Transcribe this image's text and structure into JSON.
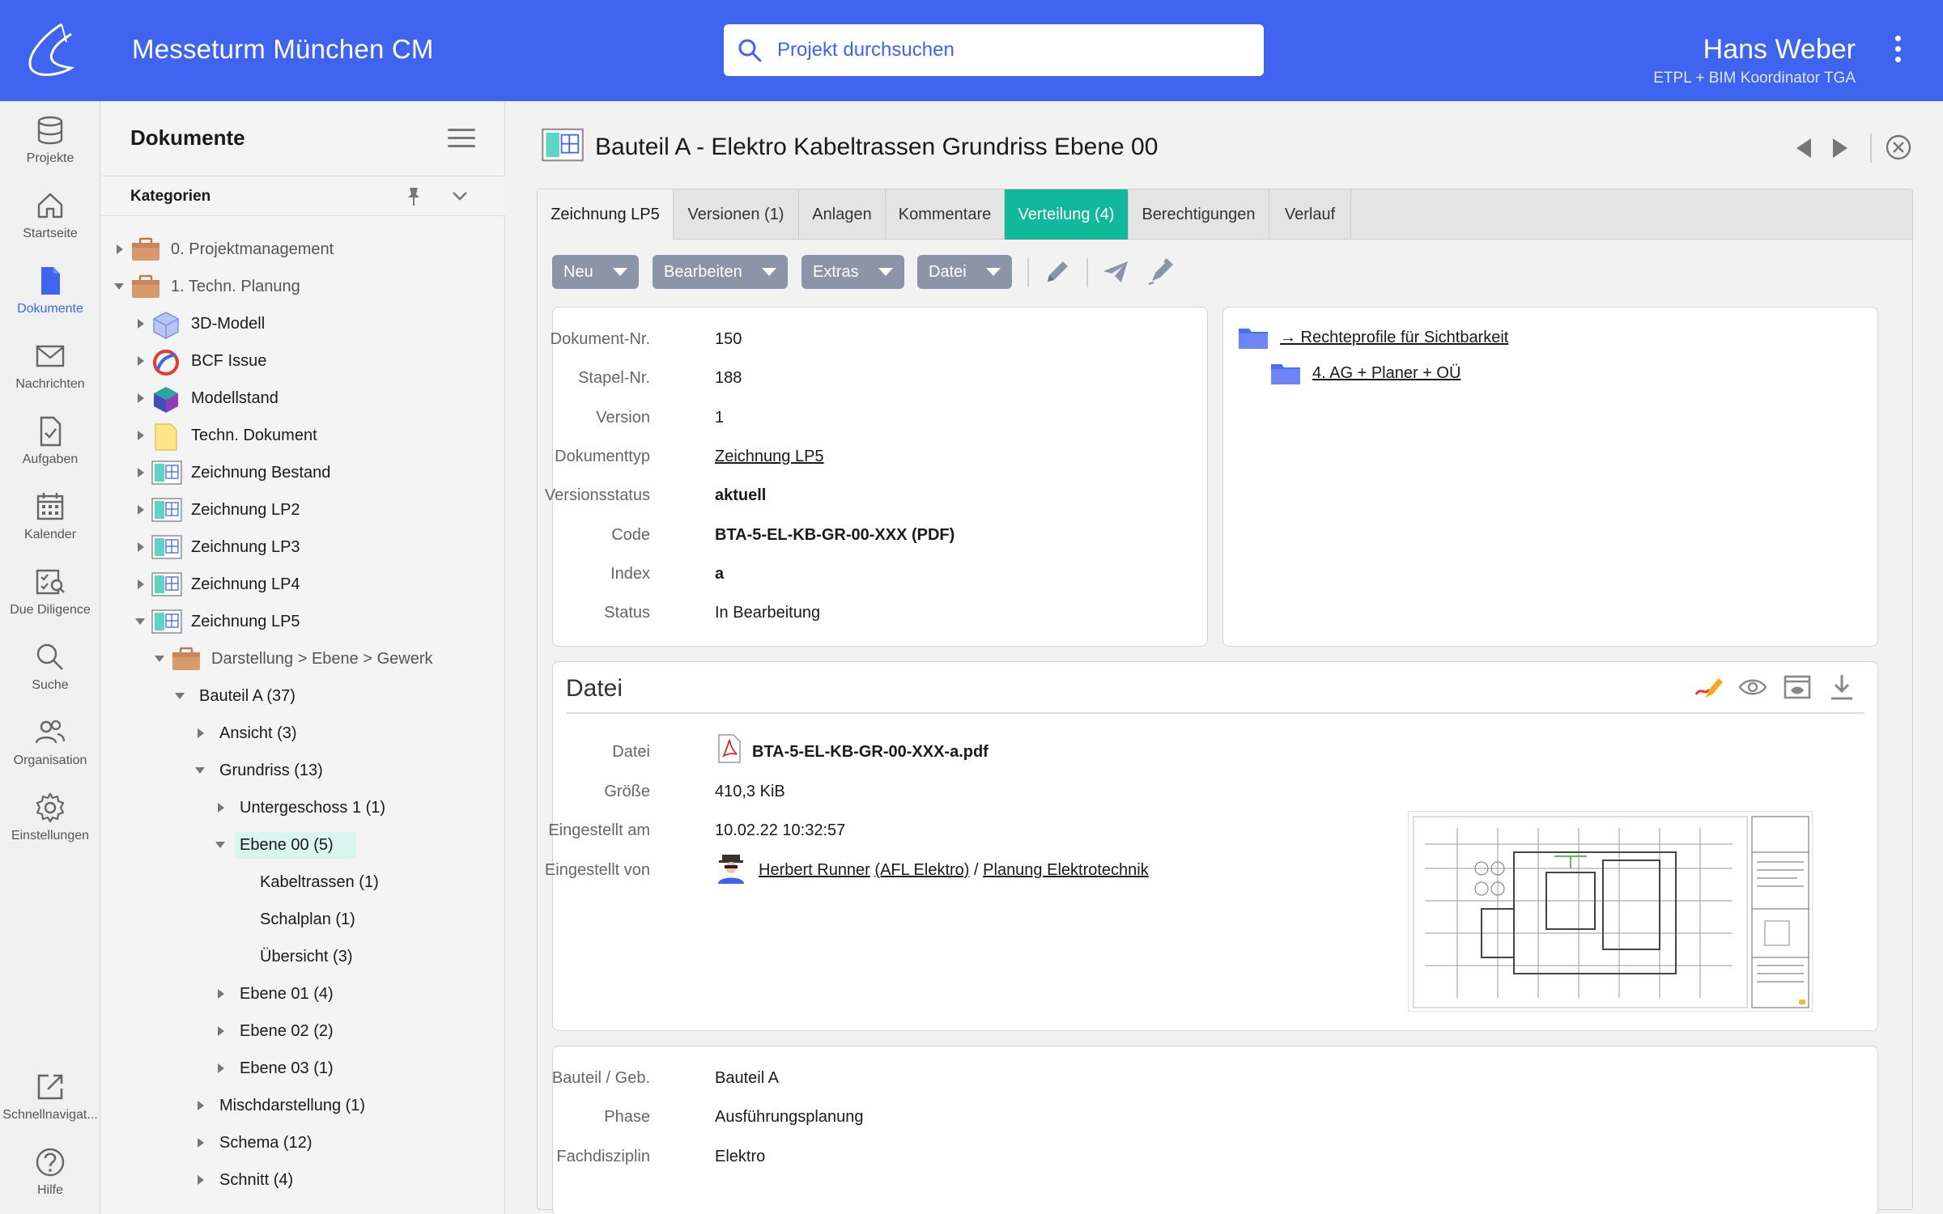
{
  "header": {
    "app_title": "Messeturm München CM",
    "search_placeholder": "Projekt durchsuchen",
    "user_name": "Hans Weber",
    "user_role": "ETPL + BIM Koordinator TGA"
  },
  "nav": [
    {
      "label": "Projekte",
      "icon": "database-icon"
    },
    {
      "label": "Startseite",
      "icon": "home-icon"
    },
    {
      "label": "Dokumente",
      "icon": "document-icon",
      "active": true
    },
    {
      "label": "Nachrichten",
      "icon": "mail-icon"
    },
    {
      "label": "Aufgaben",
      "icon": "task-icon"
    },
    {
      "label": "Kalender",
      "icon": "calendar-icon"
    },
    {
      "label": "Due Diligence",
      "icon": "due-diligence-icon"
    },
    {
      "label": "Suche",
      "icon": "search-icon"
    },
    {
      "label": "Organisation",
      "icon": "people-icon"
    },
    {
      "label": "Einstellungen",
      "icon": "gear-icon"
    },
    {
      "label": "Schnellnavigat...",
      "icon": "external-link-icon"
    },
    {
      "label": "Hilfe",
      "icon": "help-icon"
    }
  ],
  "sidebar": {
    "title": "Dokumente",
    "categories_label": "Kategorien",
    "tree": [
      {
        "label": "0. Projektmanagement"
      },
      {
        "label": "1. Techn. Planung"
      },
      {
        "label": "3D-Modell"
      },
      {
        "label": "BCF Issue"
      },
      {
        "label": "Modellstand"
      },
      {
        "label": "Techn. Dokument"
      },
      {
        "label": "Zeichnung Bestand"
      },
      {
        "label": "Zeichnung LP2"
      },
      {
        "label": "Zeichnung LP3"
      },
      {
        "label": "Zeichnung LP4"
      },
      {
        "label": "Zeichnung LP5"
      },
      {
        "label": "Darstellung > Ebene > Gewerk"
      },
      {
        "label": "Bauteil A (37)"
      },
      {
        "label": "Ansicht (3)"
      },
      {
        "label": "Grundriss (13)"
      },
      {
        "label": "Untergeschoss 1 (1)"
      },
      {
        "label": "Ebene 00 (5)"
      },
      {
        "label": "Kabeltrassen (1)"
      },
      {
        "label": "Schalplan (1)"
      },
      {
        "label": "Übersicht (3)"
      },
      {
        "label": "Ebene 01 (4)"
      },
      {
        "label": "Ebene 02 (2)"
      },
      {
        "label": "Ebene 03 (1)"
      },
      {
        "label": "Mischdarstellung (1)"
      },
      {
        "label": "Schema (12)"
      },
      {
        "label": "Schnitt (4)"
      }
    ]
  },
  "document": {
    "title": "Bauteil A - Elektro Kabeltrassen Grundriss Ebene 00",
    "tabs": [
      "Zeichnung LP5",
      "Versionen (1)",
      "Anlagen",
      "Kommentare",
      "Verteilung (4)",
      "Berechtigungen",
      "Verlauf"
    ],
    "toolbar": [
      "Neu",
      "Bearbeiten",
      "Extras",
      "Datei"
    ],
    "meta": [
      {
        "key": "Dokument-Nr.",
        "value": "150"
      },
      {
        "key": "Stapel-Nr.",
        "value": "188"
      },
      {
        "key": "Version",
        "value": "1"
      },
      {
        "key": "Dokumenttyp",
        "value": "Zeichnung LP5"
      },
      {
        "key": "Versionsstatus",
        "value": "aktuell"
      },
      {
        "key": "Code",
        "value": "BTA-5-EL-KB-GR-00-XXX (PDF)"
      },
      {
        "key": "Index",
        "value": "a"
      },
      {
        "key": "Status",
        "value": "In Bearbeitung"
      }
    ],
    "rights": [
      "→ Rechteprofile für Sichtbarkeit",
      "4. AG + Planer + OÜ"
    ],
    "file": {
      "heading": "Datei",
      "rows": [
        {
          "key": "Datei",
          "value": "BTA-5-EL-KB-GR-00-XXX-a.pdf"
        },
        {
          "key": "Größe",
          "value": "410,3 KiB"
        },
        {
          "key": "Eingestellt am",
          "value": "10.02.22 10:32:57"
        },
        {
          "key": "Eingestellt von",
          "person": "Herbert Runner",
          "company": "(AFL Elektro)",
          "sep": "/",
          "group": "Planung Elektrotechnik"
        }
      ]
    },
    "attributes": [
      {
        "key": "Bauteil / Geb.",
        "value": "Bauteil A"
      },
      {
        "key": "Phase",
        "value": "Ausführungsplanung"
      },
      {
        "key": "Fachdisziplin",
        "value": "Elektro"
      }
    ]
  },
  "colors": {
    "brand": "#3f65f0",
    "active_tab": "#12b89a",
    "button": "#8c94a7"
  }
}
